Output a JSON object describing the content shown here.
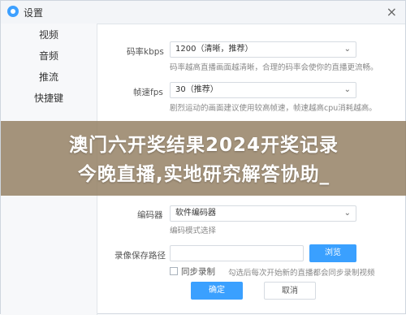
{
  "window": {
    "title": "设置",
    "close_glyph": "×",
    "app_icon": "settings-app-icon"
  },
  "sidebar": {
    "items": [
      {
        "label": "视频"
      },
      {
        "label": "音频"
      },
      {
        "label": "推流"
      },
      {
        "label": "快捷键"
      }
    ]
  },
  "video": {
    "bitrate": {
      "label": "码率kbps",
      "value": "1200（清晰，推荐）",
      "hint": "码率越高直播画面越清晰，合理的码率会使你的直播更流畅。"
    },
    "fps": {
      "label": "帧速fps",
      "value": "30（推荐）",
      "hint": "剧烈运动的画面建议使用较高帧速，帧速越高cpu消耗越高。"
    },
    "encoder": {
      "label": "编码器",
      "value": "软件编码器",
      "hint": "编码模式选择"
    },
    "record": {
      "label": "录像保存路径",
      "path_value": "",
      "browse_button": "浏览",
      "sync_label": "同步录制",
      "sync_hint": "勾选后每次开始新的直播都会同步录制视频"
    }
  },
  "buttons": {
    "ok": "确定",
    "cancel": "取消"
  },
  "overlay": {
    "line1": "澳门六开奖结果2024开奖记录",
    "line2": "今晚直播,实地研究解答协助_"
  },
  "colors": {
    "primary": "#3aa0ff",
    "overlay": "#917c5f"
  }
}
